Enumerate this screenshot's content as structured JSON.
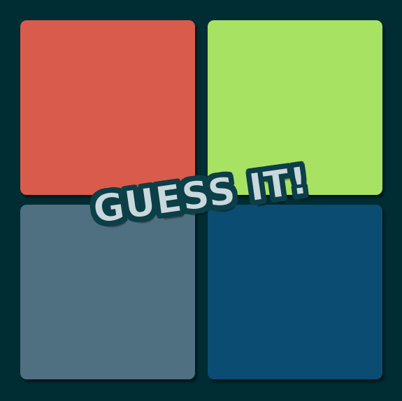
{
  "game": {
    "title": "GUESS IT!",
    "background_color": "#002c34",
    "tiles": [
      {
        "id": "top-left",
        "color": "#d95b4c"
      },
      {
        "id": "top-right",
        "color": "#a8e263"
      },
      {
        "id": "bottom-left",
        "color": "#4f7080"
      },
      {
        "id": "bottom-right",
        "color": "#0b4c73"
      }
    ]
  }
}
